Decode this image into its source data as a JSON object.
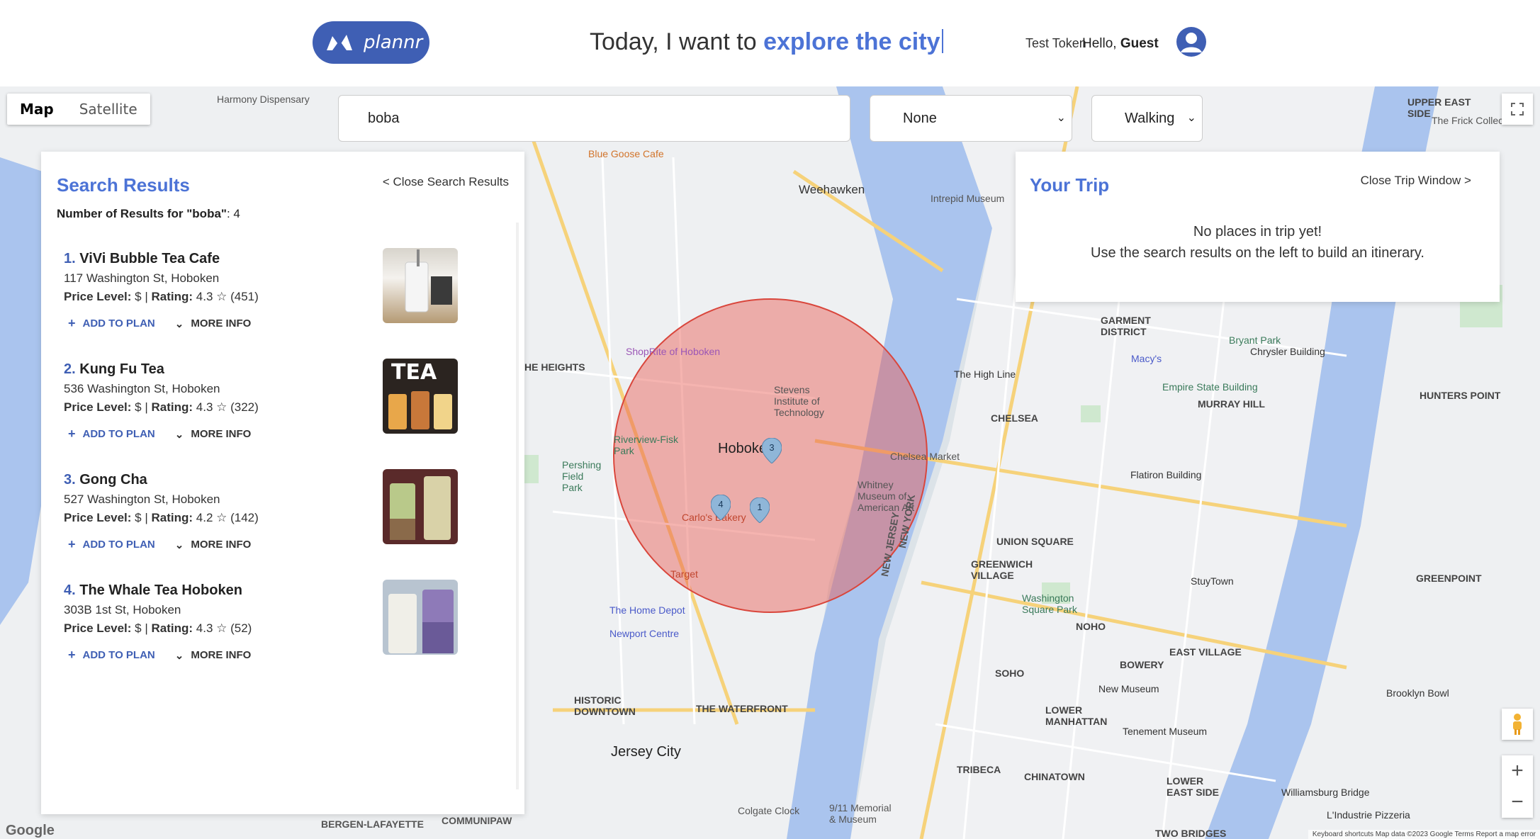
{
  "header": {
    "logo_text": "plannr",
    "tagline_prefix": "Today, I want to ",
    "tagline_accent": "explore the city",
    "test_token": "Test Token",
    "hello_prefix": "Hello, ",
    "hello_name": "Guest",
    "accent_color": "#4c73d6",
    "brand_color": "#3f5fb4"
  },
  "map": {
    "type_options": [
      "Map",
      "Satellite"
    ],
    "selected_type": "Map",
    "google_logo": "Google",
    "attribution": "Keyboard shortcuts   Map data ©2023 Google   Terms   Report a map error",
    "labels": {
      "weehawken": "Weehawken",
      "hoboken": "Hoboken",
      "jersey_city": "Jersey City",
      "union_square": "UNION SQUARE",
      "greenwich": "GREENWICH VILLAGE",
      "chelsea": "CHELSEA",
      "garment": "GARMENT DISTRICT",
      "murray_hill": "MURRAY HILL",
      "soho": "SOHO",
      "tribeca": "TRIBECA",
      "east_village": "EAST VILLAGE",
      "chinatown": "CHINATOWN",
      "lower_manhattan": "LOWER MANHATTAN",
      "greenpoint": "GREENPOINT",
      "hunters_point": "HUNTERS POINT",
      "empire": "Empire State Building",
      "high_line": "The High Line",
      "waterfront": "THE WATERFRONT",
      "historic_downtown": "HISTORIC DOWNTOWN",
      "upper_east": "UPPER EAST SIDE",
      "lower_east": "LOWER EAST SIDE",
      "williamsburg": "Williamsburg Bridge",
      "brooklyn_bowl": "Brooklyn Bowl",
      "new_jersey": "NEW JERSEY",
      "new_york": "NEW YORK",
      "stevens": "Stevens Institute of Technology",
      "shoprite": "ShopRite of Hoboken",
      "home_depot": "The Home Depot",
      "newport": "Newport Centre",
      "bryant": "Bryant Park",
      "macys": "Macy's",
      "chrysler": "Chrysler Building",
      "flatiron": "Flatiron Building",
      "washington_sq": "Washington Square Park",
      "new_museum": "New Museum",
      "tenement": "Tenement Museum",
      "stuytown": "StuyTown",
      "whitney": "Whitney Museum of American Art",
      "chelsea_market": "Chelsea Market",
      "intrepid": "Intrepid Museum",
      "pershing": "Pershing Field Park",
      "riverview": "Riverview-Fisk Park",
      "carlos": "Carlo's Bakery",
      "target": "Target",
      "bergen": "BERGEN-LAFAYETTE",
      "communipaw": "COMMUNIPAW",
      "blue_goose": "Blue Goose Cafe",
      "he_heights": "HE HEIGHTS",
      "two_bridges": "TWO BRIDGES",
      "bowery": "BOWERY",
      "noho": "NOHO",
      "harmony": "Harmony Dispensary",
      "frick": "The Frick Collection",
      "colgate": "Colgate Clock",
      "memorial": "9/11 Memorial & Museum",
      "industrie": "L'Industrie Pizzeria"
    },
    "markers": [
      "3",
      "4",
      "1"
    ]
  },
  "search": {
    "query": "boba",
    "filter_selected": "None",
    "mode_selected": "Walking"
  },
  "results": {
    "title": "Search Results",
    "close_label": "< Close Search Results",
    "count_prefix": "Number of Results for \"boba\"",
    "count_value": ": 4",
    "add_label": "ADD TO PLAN",
    "more_label": "MORE INFO",
    "price_label": "Price Level:",
    "rating_label": "Rating:",
    "items": [
      {
        "num": "1.",
        "name": "ViVi Bubble Tea Cafe",
        "address": "117 Washington St, Hoboken",
        "price": " $ | ",
        "rating": " 4.3 ☆ (451)"
      },
      {
        "num": "2.",
        "name": "Kung Fu Tea",
        "address": "536 Washington St, Hoboken",
        "price": " $ | ",
        "rating": " 4.3 ☆ (322)",
        "thumb_text": "TEA"
      },
      {
        "num": "3.",
        "name": "Gong Cha",
        "address": "527 Washington St, Hoboken",
        "price": " $ | ",
        "rating": " 4.2 ☆ (142)"
      },
      {
        "num": "4.",
        "name": "The Whale Tea Hoboken",
        "address": "303B 1st St, Hoboken",
        "price": " $ | ",
        "rating": " 4.3 ☆ (52)"
      }
    ]
  },
  "trip": {
    "title": "Your Trip",
    "close_label": "Close Trip Window >",
    "empty_line1": "No places in trip yet!",
    "empty_line2": "Use the search results on the left to build an itinerary."
  }
}
